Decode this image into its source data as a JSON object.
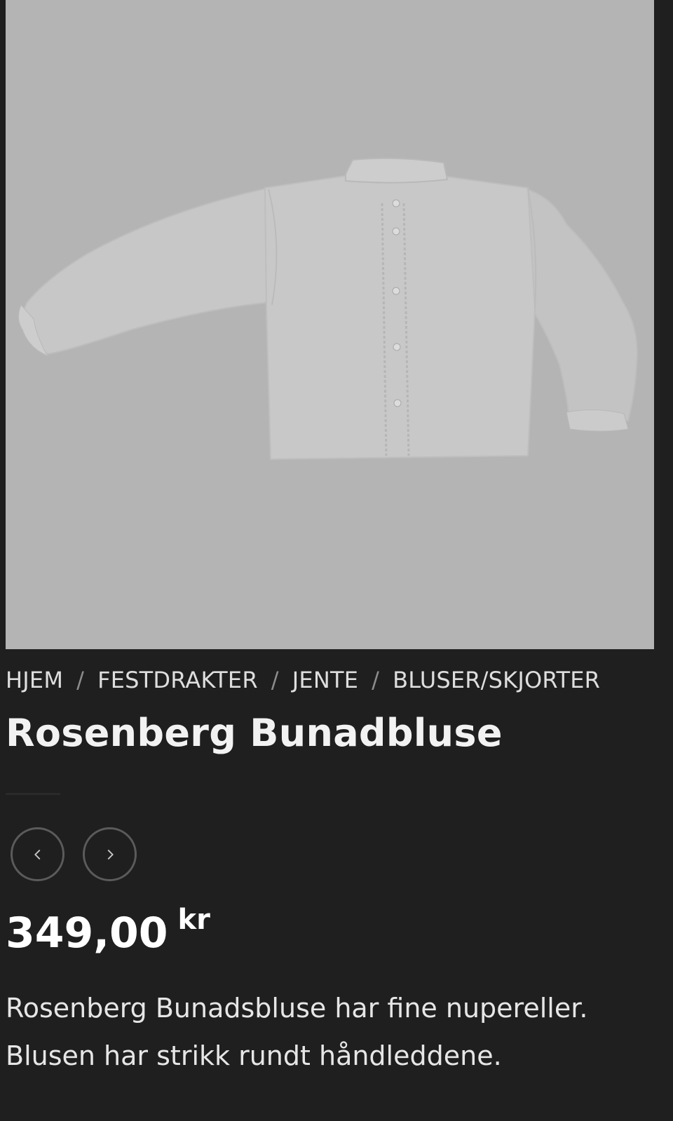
{
  "product": {
    "image_alt": "Rosenberg Bunadbluse",
    "title": "Rosenberg Bunadbluse",
    "price_amount": "349,00",
    "price_currency": "kr",
    "description": "Rosenberg Bunadsbluse har fine nupereller. Blusen har strikk rundt håndleddene."
  },
  "breadcrumb": {
    "items": [
      "HJEM",
      "FESTDRAKTER",
      "JENTE",
      "BLUSER/SKJORTER"
    ],
    "separator": "/"
  },
  "navigation": {
    "prev_icon": "chevron-left-icon",
    "next_icon": "chevron-right-icon"
  },
  "colors": {
    "background": "#1f1f1f",
    "image_overlay": "#b4b4b4",
    "text": "#f2f2f2"
  }
}
